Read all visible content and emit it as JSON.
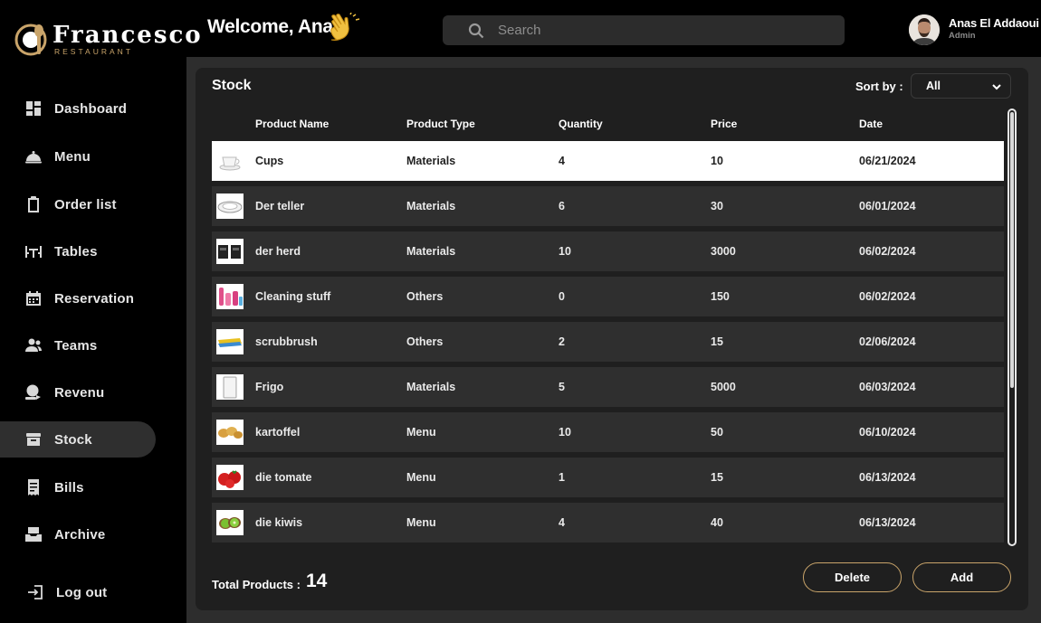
{
  "brand": {
    "name": "Francesco",
    "sub": "RESTAURANT"
  },
  "sidebar": {
    "items": [
      {
        "label": "Dashboard",
        "icon": "dashboard-icon"
      },
      {
        "label": "Menu",
        "icon": "cloche-icon"
      },
      {
        "label": "Order list",
        "icon": "clipboard-icon"
      },
      {
        "label": "Tables",
        "icon": "table-icon"
      },
      {
        "label": "Reservation",
        "icon": "calendar-icon"
      },
      {
        "label": "Teams",
        "icon": "team-icon"
      },
      {
        "label": "Revenu",
        "icon": "revenue-icon"
      },
      {
        "label": "Stock",
        "icon": "archive-box-icon",
        "active": true
      },
      {
        "label": "Bills",
        "icon": "receipt-icon"
      },
      {
        "label": "Archive",
        "icon": "archive-tray-icon"
      }
    ],
    "logout": "Log out"
  },
  "header": {
    "welcome": "Welcome, Anas",
    "search_placeholder": "Search",
    "user_name": "Anas El Addaoui",
    "user_role": "Admin"
  },
  "stock": {
    "title": "Stock",
    "sort_label": "Sort by :",
    "sort_value": "All",
    "columns": [
      "Product Name",
      "Product Type",
      "Quantity",
      "Price",
      "Date"
    ],
    "rows": [
      {
        "name": "Cups",
        "type": "Materials",
        "quantity": "4",
        "price": "10",
        "date": "06/21/2024",
        "thumb": "cup-image",
        "selected": true
      },
      {
        "name": "Der teller",
        "type": "Materials",
        "quantity": "6",
        "price": "30",
        "date": "06/01/2024",
        "thumb": "plate-image"
      },
      {
        "name": "der herd",
        "type": "Materials",
        "quantity": "10",
        "price": "3000",
        "date": "06/02/2024",
        "thumb": "stove-image"
      },
      {
        "name": "Cleaning stuff",
        "type": "Others",
        "quantity": "0",
        "price": "150",
        "date": "06/02/2024",
        "thumb": "cleaning-image"
      },
      {
        "name": "scrubbrush",
        "type": "Others",
        "quantity": "2",
        "price": "15",
        "date": "02/06/2024",
        "thumb": "sponge-image"
      },
      {
        "name": "Frigo",
        "type": "Materials",
        "quantity": "5",
        "price": "5000",
        "date": "06/03/2024",
        "thumb": "fridge-image"
      },
      {
        "name": "kartoffel",
        "type": "Menu",
        "quantity": "10",
        "price": "50",
        "date": "06/10/2024",
        "thumb": "potato-image"
      },
      {
        "name": "die tomate",
        "type": "Menu",
        "quantity": "1",
        "price": "15",
        "date": "06/13/2024",
        "thumb": "tomato-image"
      },
      {
        "name": "die kiwis",
        "type": "Menu",
        "quantity": "4",
        "price": "40",
        "date": "06/13/2024",
        "thumb": "kiwi-image"
      }
    ],
    "total_label": "Total Products :",
    "total_value": "14",
    "delete_label": "Delete",
    "add_label": "Add"
  },
  "colors": {
    "accent": "#c9a46a",
    "panel": "#1f1f1f",
    "row": "#2f2f2f",
    "selected_row": "#ffffff"
  }
}
